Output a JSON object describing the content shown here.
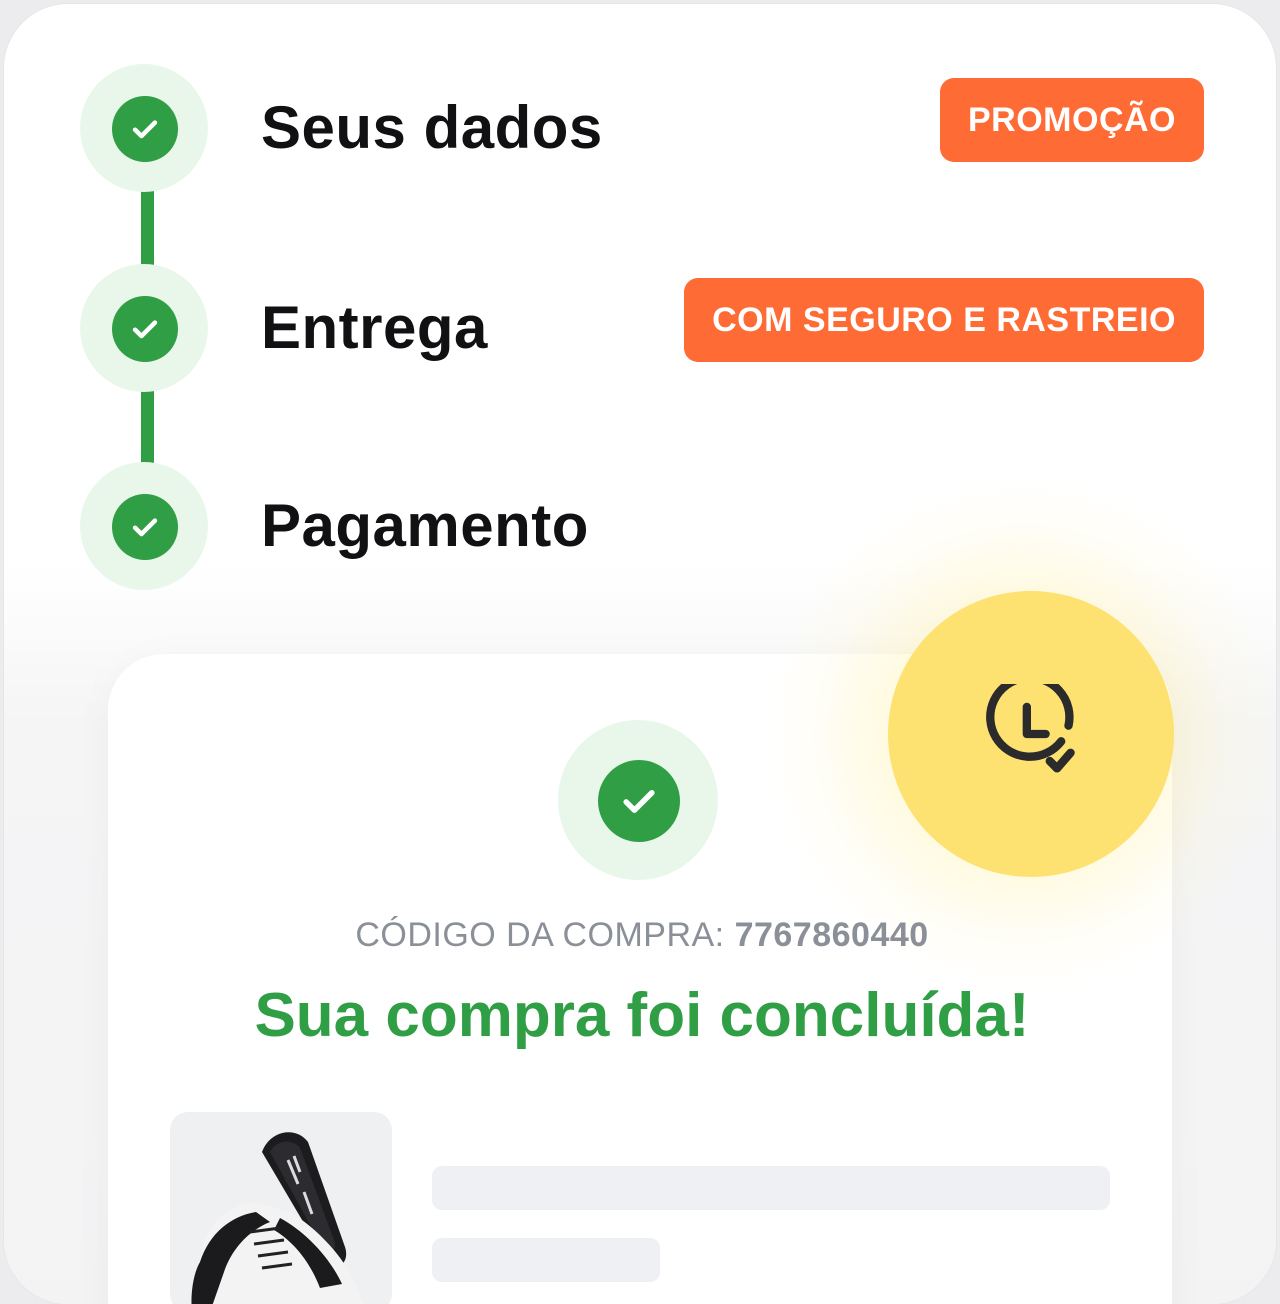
{
  "steps": [
    {
      "label": "Seus dados",
      "badge": "PROMOÇÃO"
    },
    {
      "label": "Entrega",
      "badge": "COM SEGURO E RASTREIO"
    },
    {
      "label": "Pagamento",
      "badge": ""
    }
  ],
  "order": {
    "code_label": "CÓDIGO DA COMPRA: ",
    "code_value": "7767860440",
    "success_title": "Sua compra foi concluída!"
  },
  "icons": {
    "step_check": "check-icon",
    "status": "clock-check-icon",
    "product": "sneaker-image"
  },
  "colors": {
    "accent_green": "#2f9e44",
    "badge_orange": "#ff6b35",
    "clock_yellow": "#fde272"
  }
}
